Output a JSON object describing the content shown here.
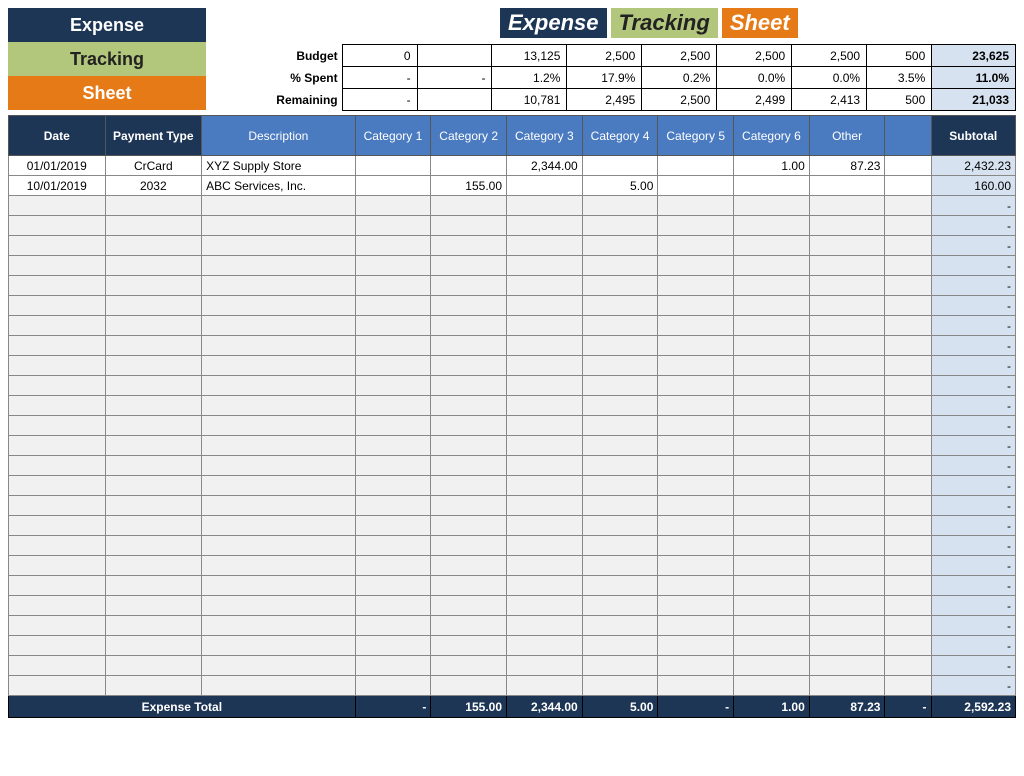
{
  "logo": {
    "l1": "Expense",
    "l2": "Tracking",
    "l3": "Sheet"
  },
  "title": {
    "t1": "Expense",
    "t2": "Tracking",
    "t3": "Sheet"
  },
  "summary": {
    "rows": [
      {
        "label": "Budget",
        "vals": [
          "0",
          "",
          "13,125",
          "2,500",
          "2,500",
          "2,500",
          "2,500",
          "500"
        ],
        "total": "23,625"
      },
      {
        "label": "% Spent",
        "vals": [
          "-",
          "-",
          "1.2%",
          "17.9%",
          "0.2%",
          "0.0%",
          "0.0%",
          "3.5%"
        ],
        "total": "11.0%"
      },
      {
        "label": "Remaining",
        "vals": [
          "-",
          "",
          "10,781",
          "2,495",
          "2,500",
          "2,499",
          "2,413",
          "500"
        ],
        "total": "21,033"
      }
    ]
  },
  "headers": {
    "date": "Date",
    "ptype": "Payment Type",
    "desc": "Description",
    "c1": "Category 1",
    "c2": "Category 2",
    "c3": "Category 3",
    "c4": "Category 4",
    "c5": "Category 5",
    "c6": "Category 6",
    "other": "Other",
    "blank": "",
    "subtotal": "Subtotal"
  },
  "rows": [
    {
      "date": "01/01/2019",
      "ptype": "CrCard",
      "desc": "XYZ Supply Store",
      "c1": "",
      "c2": "",
      "c3": "2,344.00",
      "c4": "",
      "c5": "",
      "c6": "1.00",
      "other": "87.23",
      "blank": "",
      "sub": "2,432.23"
    },
    {
      "date": "10/01/2019",
      "ptype": "2032",
      "desc": "ABC Services, Inc.",
      "c1": "",
      "c2": "155.00",
      "c3": "",
      "c4": "5.00",
      "c5": "",
      "c6": "",
      "other": "",
      "blank": "",
      "sub": "160.00"
    }
  ],
  "emptyRowCount": 25,
  "emptyDash": "-",
  "footer": {
    "label": "Expense Total",
    "c1": "-",
    "c2": "155.00",
    "c3": "2,344.00",
    "c4": "5.00",
    "c5": "-",
    "c6": "1.00",
    "other": "87.23",
    "blank": "-",
    "sub": "2,592.23"
  }
}
